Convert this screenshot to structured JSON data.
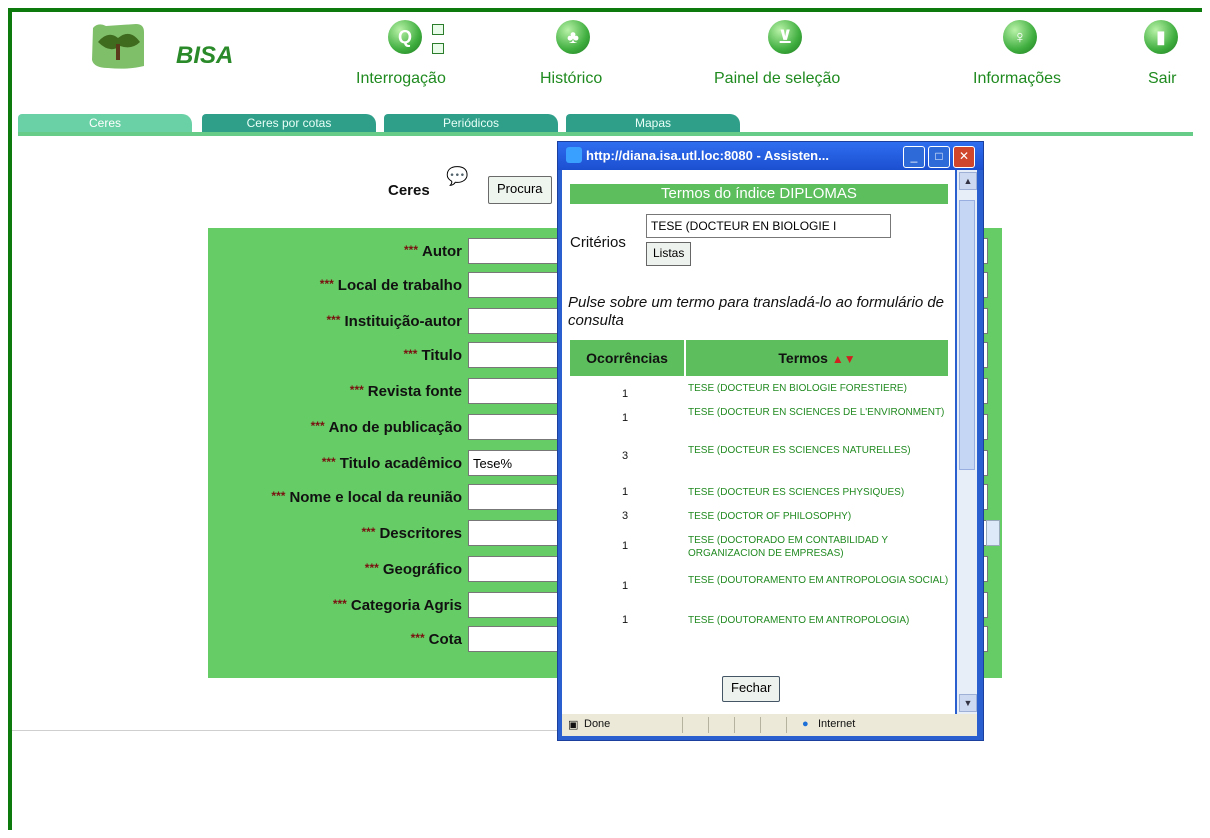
{
  "app": {
    "logo_text": "BISA"
  },
  "nav": {
    "items": [
      {
        "label": "Interrogação",
        "icon": "search-icon"
      },
      {
        "label": "Histórico",
        "icon": "tree-icon"
      },
      {
        "label": "Painel de seleção",
        "icon": "cart-icon"
      },
      {
        "label": "Informações",
        "icon": "lightbulb-icon"
      },
      {
        "label": "Sair",
        "icon": "door-exit-icon"
      }
    ]
  },
  "tabs": [
    "Ceres",
    "Ceres por cotas",
    "Periódicos",
    "Mapas"
  ],
  "form": {
    "title": "Ceres",
    "search_button": "Procura",
    "stars": "***",
    "fields": [
      {
        "label": "Autor",
        "value": ""
      },
      {
        "label": "Local de trabalho",
        "value": ""
      },
      {
        "label": "Instituição-autor",
        "value": ""
      },
      {
        "label": "Titulo",
        "value": ""
      },
      {
        "label": "Revista fonte",
        "value": ""
      },
      {
        "label": "Ano de publicação",
        "value": ""
      },
      {
        "label": "Titulo acadêmico",
        "value": "Tese%"
      },
      {
        "label": "Nome e local da reunião",
        "value": ""
      },
      {
        "label": "Descritores",
        "value": ""
      },
      {
        "label": "Geográfico",
        "value": ""
      },
      {
        "label": "Categoria Agris",
        "value": ""
      },
      {
        "label": "Cota",
        "value": ""
      }
    ]
  },
  "popup": {
    "window_title": "http://diana.isa.utl.loc:8080 - Assisten...",
    "heading": "Termos do índice DIPLOMAS",
    "criteria_label": "Critérios",
    "criteria_value": "TESE (DOCTEUR EN BIOLOGIE I",
    "lists_button": "Listas",
    "instruction": "Pulse sobre um termo para transladá-lo ao formulário de consulta",
    "col_count": "Ocorrências",
    "col_terms": "Termos",
    "rows": [
      {
        "count": "1",
        "term": "TESE (DOCTEUR EN BIOLOGIE FORESTIERE)"
      },
      {
        "count": "1",
        "term": "TESE (DOCTEUR EN SCIENCES DE L'ENVIRONMENT)"
      },
      {
        "count": "3",
        "term": "TESE (DOCTEUR ES SCIENCES NATURELLES)"
      },
      {
        "count": "1",
        "term": "TESE (DOCTEUR ES SCIENCES PHYSIQUES)"
      },
      {
        "count": "3",
        "term": "TESE (DOCTOR OF PHILOSOPHY)"
      },
      {
        "count": "1",
        "term": "TESE (DOCTORADO EM CONTABILIDAD Y ORGANIZACION DE EMPRESAS)"
      },
      {
        "count": "1",
        "term": "TESE (DOUTORAMENTO EM ANTROPOLOGIA SOCIAL)"
      },
      {
        "count": "1",
        "term": "TESE (DOUTORAMENTO EM ANTROPOLOGIA)"
      }
    ],
    "close_button": "Fechar",
    "status_done": "Done",
    "status_zone": "Internet"
  },
  "colors": {
    "frame": "#0c7a0c",
    "panel": "#66cc66",
    "tab": "#2f9f8a",
    "link": "#218a21"
  }
}
